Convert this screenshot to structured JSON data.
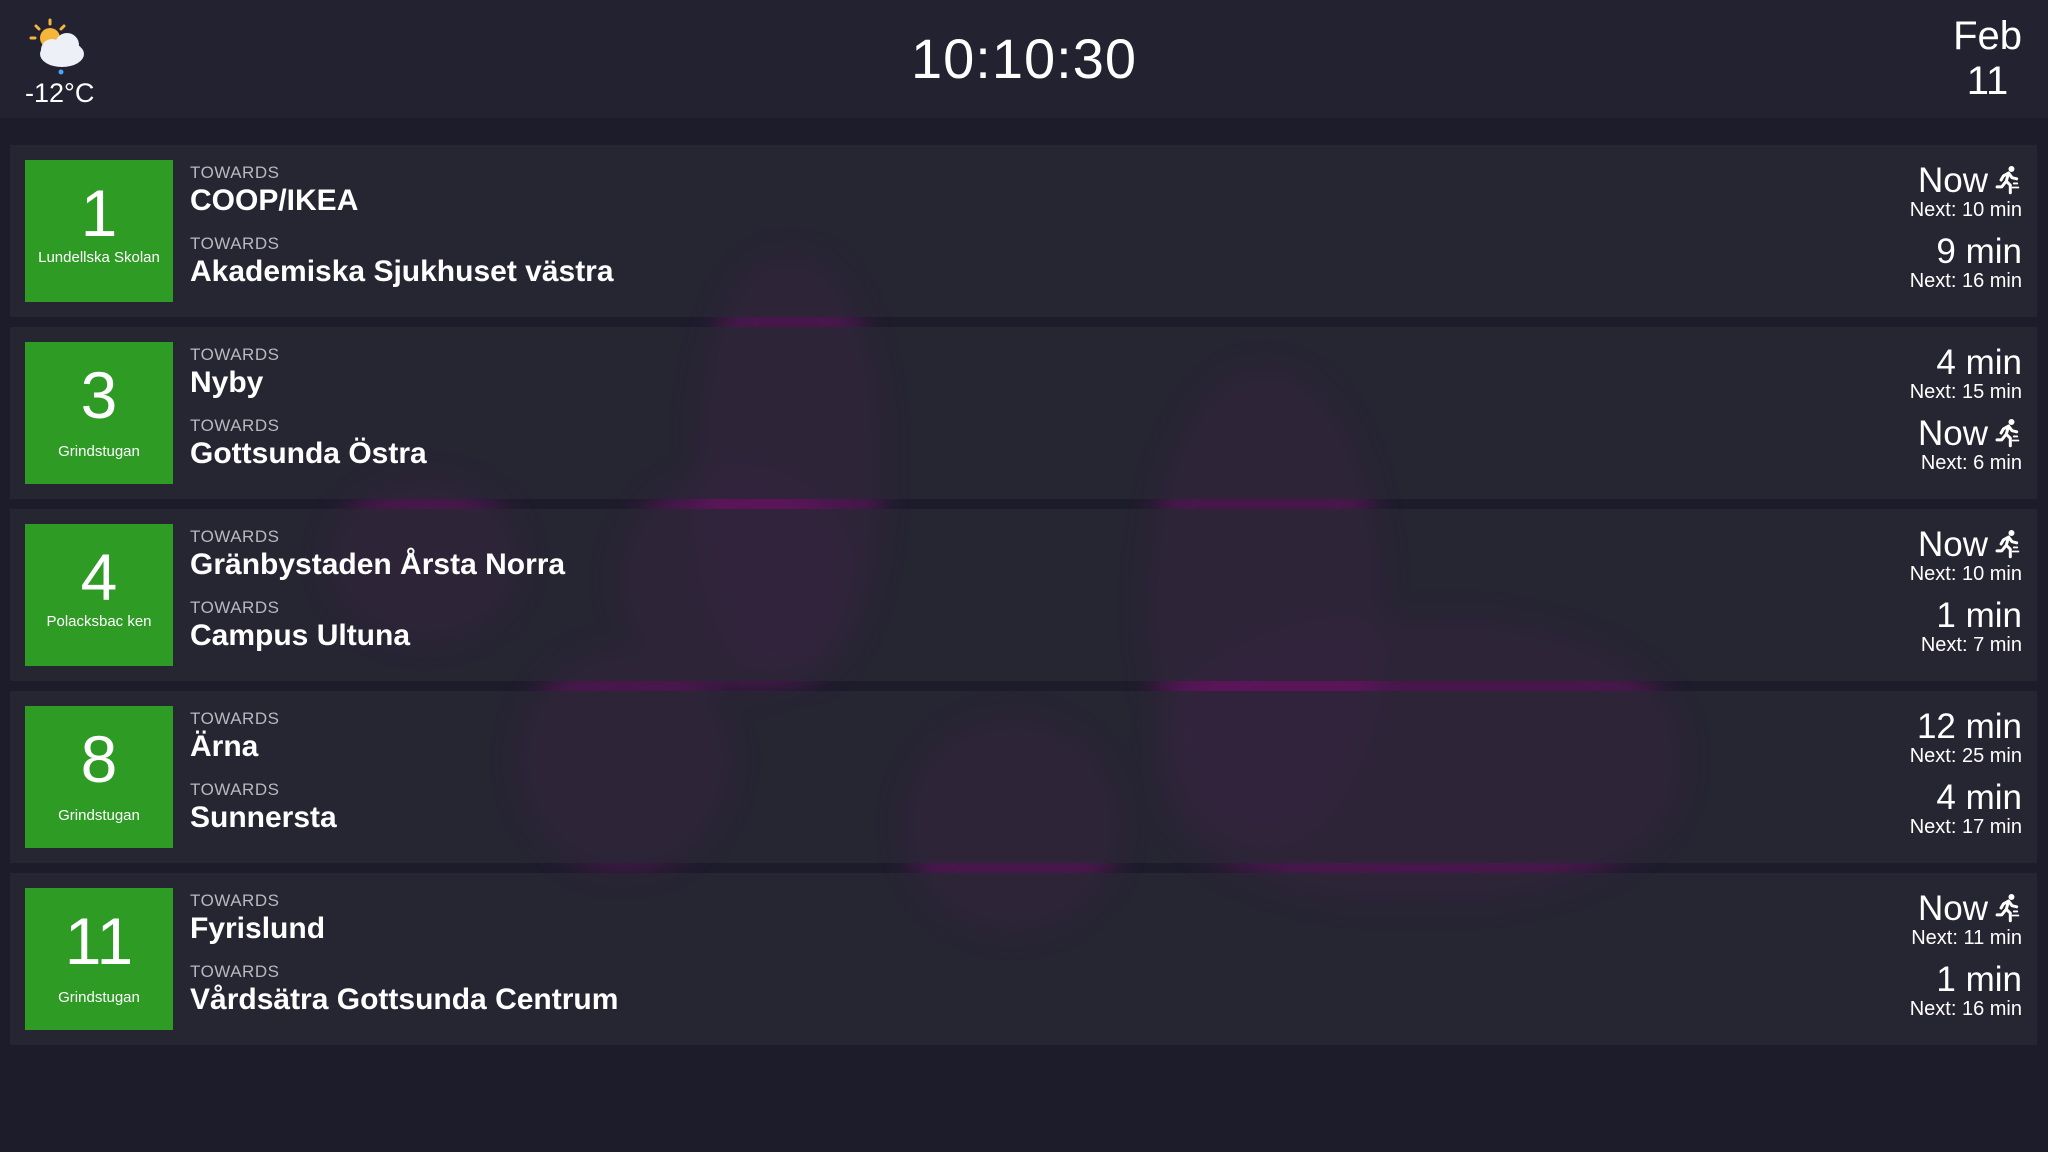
{
  "header": {
    "weather_icon": "partly-cloudy-snow-icon",
    "temperature": "-12°C",
    "clock": "10:10:30",
    "date_month": "Feb",
    "date_day": "11"
  },
  "colors": {
    "background": "#1d1c2b",
    "header": "#232230",
    "row": "#282734",
    "badge": "#2d9b24",
    "blob": "#6b1466"
  },
  "routes": [
    {
      "line": "1",
      "stop": "Lundellska Skolan",
      "departures": [
        {
          "label": "TOWARDS",
          "destination": "COOP/IKEA",
          "time": "Now",
          "running": true,
          "next": "Next: 10 min"
        },
        {
          "label": "TOWARDS",
          "destination": "Akademiska Sjukhuset västra",
          "time": "9 min",
          "running": false,
          "next": "Next: 16 min"
        }
      ]
    },
    {
      "line": "3",
      "stop": "Grindstugan",
      "departures": [
        {
          "label": "TOWARDS",
          "destination": "Nyby",
          "time": "4 min",
          "running": false,
          "next": "Next: 15 min"
        },
        {
          "label": "TOWARDS",
          "destination": "Gottsunda Östra",
          "time": "Now",
          "running": true,
          "next": "Next: 6 min"
        }
      ]
    },
    {
      "line": "4",
      "stop": "Polacksbac ken",
      "departures": [
        {
          "label": "TOWARDS",
          "destination": "Gränbystaden Årsta Norra",
          "time": "Now",
          "running": true,
          "next": "Next: 10 min"
        },
        {
          "label": "TOWARDS",
          "destination": "Campus Ultuna",
          "time": "1 min",
          "running": false,
          "next": "Next: 7 min"
        }
      ]
    },
    {
      "line": "8",
      "stop": "Grindstugan",
      "departures": [
        {
          "label": "TOWARDS",
          "destination": "Ärna",
          "time": "12 min",
          "running": false,
          "next": "Next: 25 min"
        },
        {
          "label": "TOWARDS",
          "destination": "Sunnersta",
          "time": "4 min",
          "running": false,
          "next": "Next: 17 min"
        }
      ]
    },
    {
      "line": "11",
      "stop": "Grindstugan",
      "departures": [
        {
          "label": "TOWARDS",
          "destination": "Fyrislund",
          "time": "Now",
          "running": true,
          "next": "Next: 11 min"
        },
        {
          "label": "TOWARDS",
          "destination": "Vårdsätra Gottsunda Centrum",
          "time": "1 min",
          "running": false,
          "next": "Next: 16 min"
        }
      ]
    }
  ]
}
